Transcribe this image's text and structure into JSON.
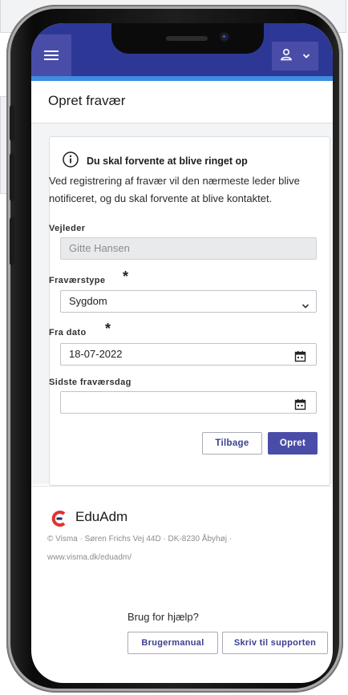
{
  "app": {
    "title": "Opret fravær",
    "user_menu_chevron": "⌄"
  },
  "alert": {
    "icon": "info-icon",
    "title": "Du skal forvente at blive ringet op",
    "text": "Ved registrering af fravær vil den nærmeste leder blive notificeret, og du skal forvente at blive kontaktet."
  },
  "form": {
    "supervisor_label": "Vejleder",
    "supervisor_value": "Gitte Hansen",
    "type_label": "Fraværstype",
    "type_value": "Sygdom",
    "from_label": "Fra dato",
    "from_value": "18-07-2022",
    "last_label": "Sidste fraværsdag",
    "last_value": "",
    "required_mark": "*",
    "back_label": "Tilbage",
    "submit_label": "Opret"
  },
  "footer": {
    "brand": "EduAdm",
    "address_line1": "© Visma · Søren Frichs Vej 44D · DK-8230 Åbyhøj ·",
    "address_line2": "www.visma.dk/eduadm/",
    "help_text": "Brug for hjælp?",
    "manual_label": "Brugermanual",
    "support_label": "Skriv til supporten"
  },
  "colors": {
    "header": "#2d3896",
    "accent": "#4a4da8",
    "stripe": "#3f8de0",
    "brand_red": "#e0322d"
  }
}
